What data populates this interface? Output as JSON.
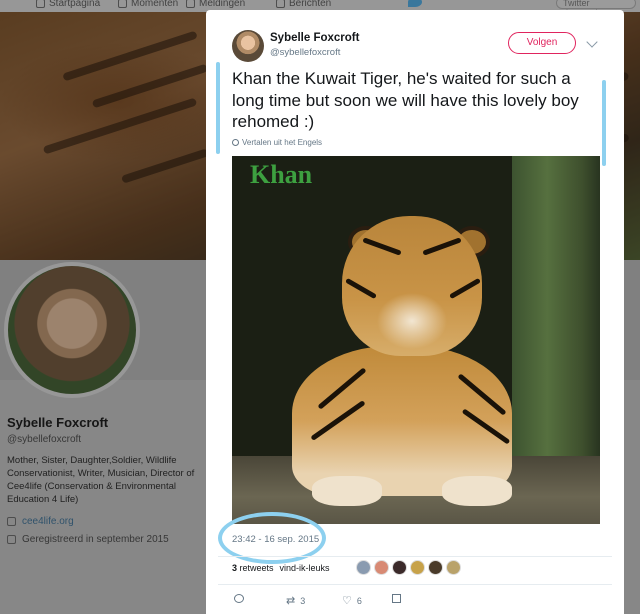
{
  "topnav": {
    "home": "Startpagina",
    "moments": "Momenten",
    "notifications": "Meldingen",
    "messages": "Berichten",
    "search_placeholder": "Twitter doorzoeken"
  },
  "profile": {
    "name": "Sybelle Foxcroft",
    "handle": "@sybellefoxcroft",
    "bio": "Mother, Sister, Daughter,Soldier, Wildlife Conservationist, Writer, Musician, Director of Cee4life (Conservation & Environmental Education 4 Life)",
    "website": "cee4life.org",
    "joined": "Geregistreerd in september 2015"
  },
  "tweet": {
    "author_name": "Sybelle Foxcroft",
    "author_handle": "@sybellefoxcroft",
    "follow_label": "Volgen",
    "text": "Khan the Kuwait Tiger, he's waited for such a long time but soon we will have this lovely boy rehomed :)",
    "translate_label": "Vertalen uit het Engels",
    "image_caption": "Khan",
    "timestamp": "23:42 - 16 sep. 2015",
    "retweets_count": "3",
    "retweets_label": "retweets",
    "likes_label": "vind-ik-leuks",
    "reply_count": "",
    "retweet_action_count": "3",
    "like_action_count": "6"
  },
  "colors": {
    "follow": "#e0245e",
    "annotation": "#8dd0ef",
    "caption": "#3da040",
    "secondary_text": "#657786"
  },
  "icons": [
    "home-icon",
    "lightning-icon",
    "bell-icon",
    "mail-icon",
    "chevron-down-icon",
    "globe-icon",
    "reply-icon",
    "retweet-icon",
    "heart-icon",
    "dm-icon",
    "link-icon",
    "calendar-icon"
  ]
}
